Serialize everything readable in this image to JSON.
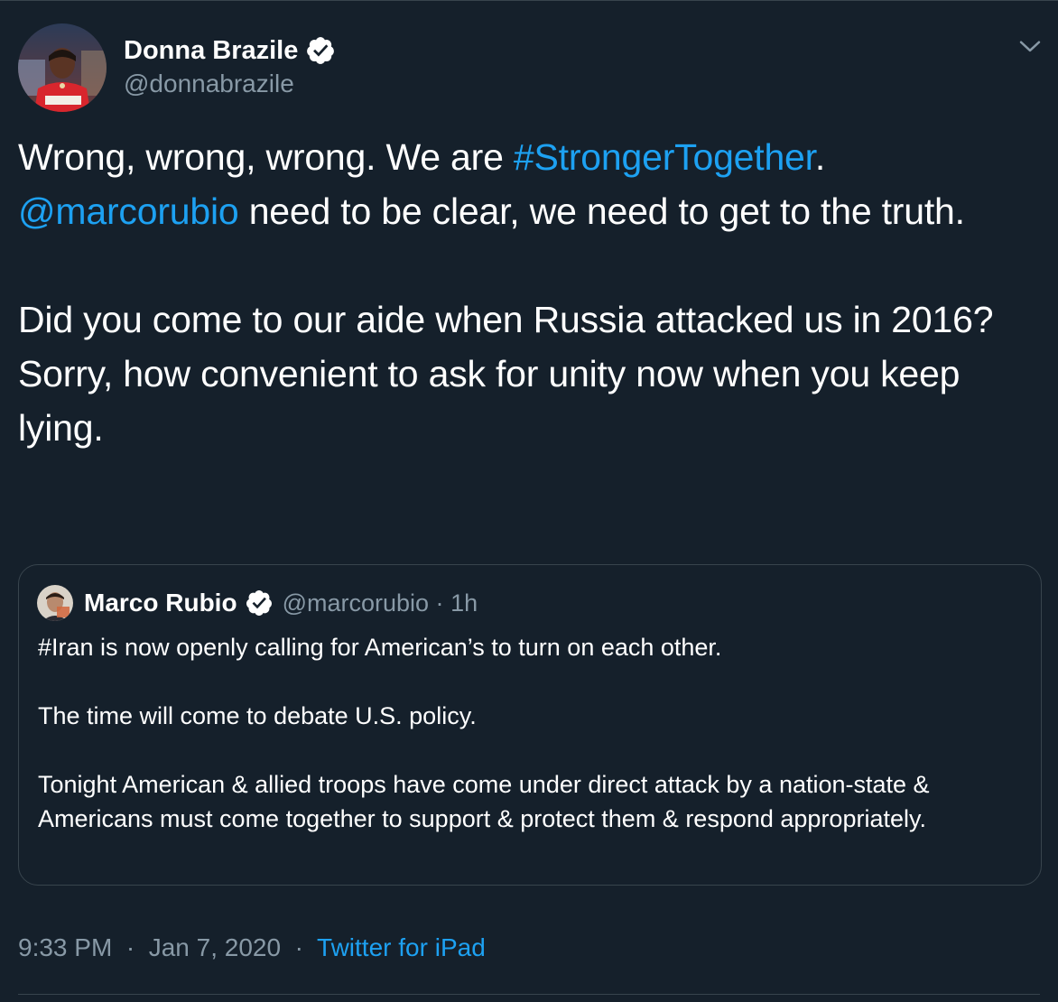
{
  "author": {
    "name": "Donna Brazile",
    "handle": "@donnabrazile"
  },
  "tweet": {
    "text_1": "Wrong, wrong, wrong. We are ",
    "hashtag": "#StrongerTogether",
    "text_2": ".",
    "mention": "@marcorubio",
    "text_3": " need to be clear, we need to get to the truth.",
    "paragraph_2": "Did you come to our aide when Russia attacked us in 2016? Sorry, how convenient to ask for unity now when you keep lying."
  },
  "quoted_tweet": {
    "name": "Marco Rubio",
    "handle": "@marcorubio",
    "separator": "·",
    "time": "1h",
    "paragraph_1": "#Iran is now openly calling for American’s to turn on each other.",
    "paragraph_2": "The time will come to debate U.S. policy.",
    "paragraph_3": "Tonight American & allied troops have come under direct attack by a nation-state & Americans must come together to support & protect them & respond appropriately."
  },
  "footer": {
    "time": "9:33 PM",
    "separator_1": "·",
    "date": "Jan 7, 2020",
    "separator_2": "·",
    "source": "Twitter for iPad"
  },
  "colors": {
    "background": "#15202b",
    "link": "#1da1f2",
    "secondary_text": "#8899a6",
    "border": "#38444d"
  },
  "icons": {
    "verified": "verified-badge-icon",
    "menu": "chevron-down-icon"
  }
}
